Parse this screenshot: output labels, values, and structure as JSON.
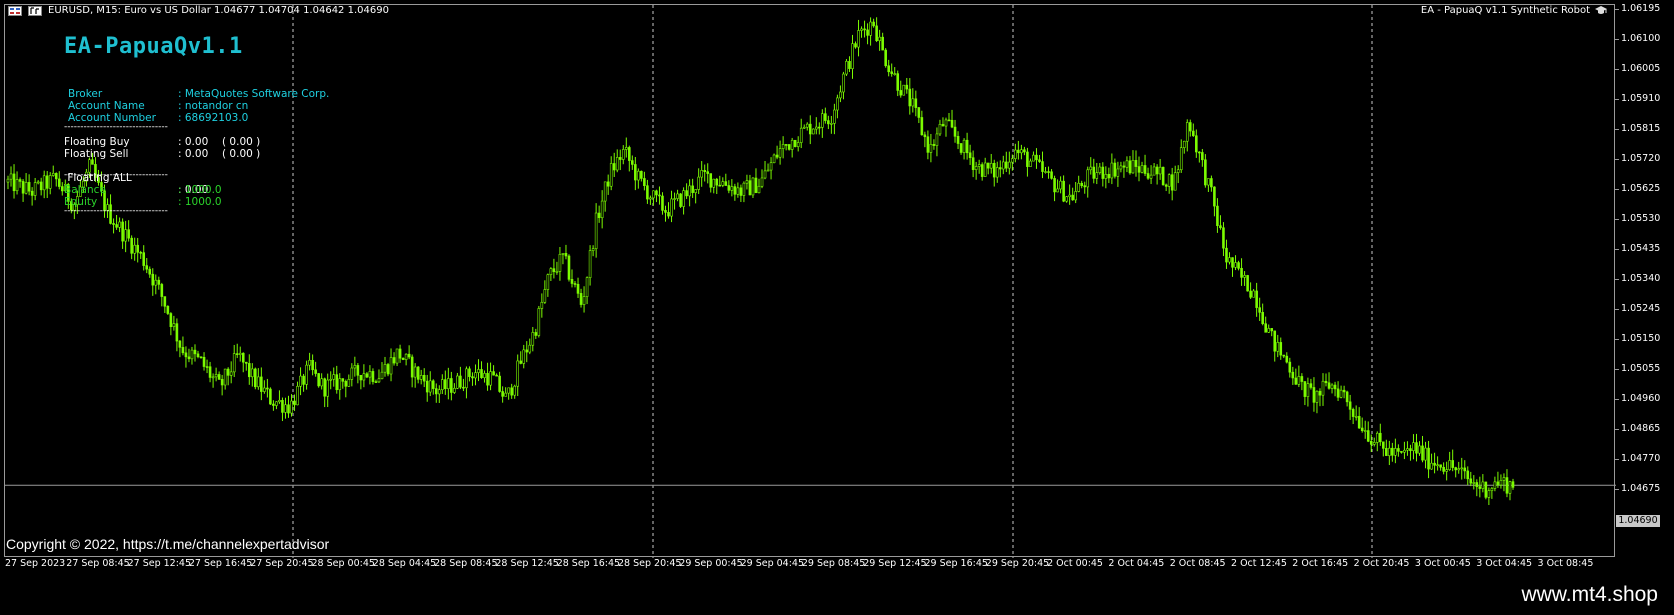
{
  "chart_header": {
    "symbol_text": "EURUSD, M15:  Euro vs US Dollar  1.04677 1.04704 1.04642 1.04690",
    "ea_label": "EA - PapuaQ v1.1 Synthetic Robot",
    "icons": [
      "chart-window-icon",
      "chart-mode-icon",
      "graduation-cap-icon"
    ]
  },
  "panel": {
    "title": "EA-PapuaQv1.1",
    "account": [
      {
        "label": "Broker",
        "value": ": MetaQuotes Software Corp."
      },
      {
        "label": "Account Name",
        "value": ": notandor cn"
      },
      {
        "label": "Account Number",
        "value": ": 68692103.0"
      }
    ],
    "separator": "--------------------------------",
    "floating": [
      {
        "label": "Floating Buy",
        "value": ": 0.00",
        "extra": "( 0.00 )"
      },
      {
        "label": "Floating Sell",
        "value": ": 0.00",
        "extra": "( 0.00 )"
      },
      {
        "label": " Floating ALL",
        "value": ": 0.00",
        "extra": ""
      }
    ],
    "balance": [
      {
        "label": "Balance",
        "value": ": 1000.0"
      },
      {
        "label": "Equity",
        "value": ": 1000.0"
      }
    ]
  },
  "copyright": "Copyright © 2022, https://t.me/channelexpertadvisor",
  "site": "www.mt4.shop",
  "current_price": "1.04690",
  "colors": {
    "background": "#000000",
    "candle": "#7CFC00",
    "title": "#1fbfd0",
    "grid": "#c8c8c8"
  },
  "chart_data": {
    "type": "candlestick",
    "symbol": "EURUSD",
    "timeframe": "M15",
    "ylim": [
      1.045,
      1.062
    ],
    "y_ticks": [
      "1.06195",
      "1.06100",
      "1.06005",
      "1.05910",
      "1.05815",
      "1.05720",
      "1.05625",
      "1.05530",
      "1.05435",
      "1.05340",
      "1.05245",
      "1.05150",
      "1.05055",
      "1.04960",
      "1.04865",
      "1.04770",
      "1.04675"
    ],
    "x_ticks": [
      "27 Sep 2023",
      "27 Sep 08:45",
      "27 Sep 12:45",
      "27 Sep 16:45",
      "27 Sep 20:45",
      "28 Sep 00:45",
      "28 Sep 04:45",
      "28 Sep 08:45",
      "28 Sep 12:45",
      "28 Sep 16:45",
      "28 Sep 20:45",
      "29 Sep 00:45",
      "29 Sep 04:45",
      "29 Sep 08:45",
      "29 Sep 12:45",
      "29 Sep 16:45",
      "29 Sep 20:45",
      "2 Oct 00:45",
      "2 Oct 04:45",
      "2 Oct 08:45",
      "2 Oct 12:45",
      "2 Oct 16:45",
      "2 Oct 20:45",
      "3 Oct 00:45",
      "3 Oct 04:45",
      "3 Oct 08:45"
    ],
    "day_separators": [
      "28 Sep 00:00",
      "29 Sep 00:00",
      "2 Oct 00:00",
      "3 Oct 00:00"
    ],
    "close_path": [
      [
        0,
        1.0565
      ],
      [
        10,
        1.0562
      ],
      [
        20,
        1.0566
      ],
      [
        28,
        1.0558
      ],
      [
        35,
        1.057
      ],
      [
        42,
        1.0556
      ],
      [
        50,
        1.0548
      ],
      [
        58,
        1.054
      ],
      [
        66,
        1.0528
      ],
      [
        74,
        1.0512
      ],
      [
        82,
        1.0508
      ],
      [
        90,
        1.05
      ],
      [
        98,
        1.051
      ],
      [
        104,
        1.0503
      ],
      [
        112,
        1.0496
      ],
      [
        120,
        1.0494
      ],
      [
        128,
        1.0506
      ],
      [
        134,
        1.05
      ],
      [
        142,
        1.0502
      ],
      [
        150,
        1.0505
      ],
      [
        158,
        1.0504
      ],
      [
        166,
        1.0511
      ],
      [
        174,
        1.0504
      ],
      [
        182,
        1.0499
      ],
      [
        190,
        1.0501
      ],
      [
        198,
        1.0505
      ],
      [
        206,
        1.0503
      ],
      [
        212,
        1.0496
      ],
      [
        218,
        1.0508
      ],
      [
        224,
        1.0518
      ],
      [
        230,
        1.0535
      ],
      [
        236,
        1.0541
      ],
      [
        244,
        1.0526
      ],
      [
        250,
        1.0552
      ],
      [
        256,
        1.0568
      ],
      [
        262,
        1.0575
      ],
      [
        268,
        1.0566
      ],
      [
        274,
        1.056
      ],
      [
        280,
        1.0556
      ],
      [
        288,
        1.0561
      ],
      [
        296,
        1.0567
      ],
      [
        304,
        1.0565
      ],
      [
        312,
        1.0562
      ],
      [
        320,
        1.0565
      ],
      [
        328,
        1.0575
      ],
      [
        336,
        1.058
      ],
      [
        342,
        1.0583
      ],
      [
        350,
        1.0586
      ],
      [
        356,
        1.06
      ],
      [
        362,
        1.0612
      ],
      [
        368,
        1.0616
      ],
      [
        372,
        1.0606
      ],
      [
        378,
        1.0597
      ],
      [
        384,
        1.059
      ],
      [
        392,
        1.0575
      ],
      [
        398,
        1.0584
      ],
      [
        404,
        1.0578
      ],
      [
        412,
        1.057
      ],
      [
        420,
        1.0568
      ],
      [
        428,
        1.0575
      ],
      [
        436,
        1.0571
      ],
      [
        444,
        1.0565
      ],
      [
        452,
        1.056
      ],
      [
        460,
        1.0567
      ],
      [
        468,
        1.0569
      ],
      [
        476,
        1.057
      ],
      [
        484,
        1.0569
      ],
      [
        490,
        1.0567
      ],
      [
        496,
        1.0565
      ],
      [
        502,
        1.0585
      ],
      [
        506,
        1.0575
      ],
      [
        512,
        1.056
      ],
      [
        518,
        1.0541
      ],
      [
        524,
        1.0535
      ],
      [
        530,
        1.053
      ],
      [
        538,
        1.0514
      ],
      [
        544,
        1.0508
      ],
      [
        550,
        1.05
      ],
      [
        556,
        1.0497
      ],
      [
        562,
        1.0501
      ],
      [
        568,
        1.0498
      ],
      [
        574,
        1.049
      ],
      [
        580,
        1.0484
      ],
      [
        586,
        1.048
      ],
      [
        592,
        1.0478
      ],
      [
        598,
        1.0481
      ],
      [
        604,
        1.0477
      ],
      [
        610,
        1.0476
      ],
      [
        616,
        1.0474
      ],
      [
        622,
        1.047
      ],
      [
        628,
        1.0468
      ],
      [
        634,
        1.047
      ],
      [
        640,
        1.0469
      ]
    ]
  }
}
